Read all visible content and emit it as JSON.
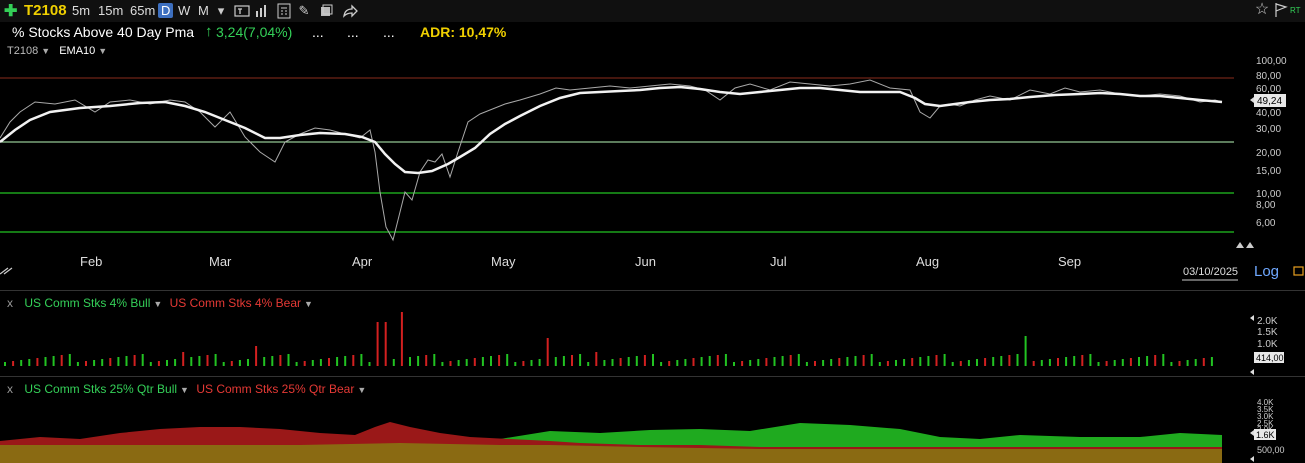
{
  "toolbar": {
    "ticker": "T2108",
    "timeframes": [
      "5m",
      "15m",
      "65m",
      "D",
      "W",
      "M"
    ],
    "active_timeframe": "D"
  },
  "header": {
    "title": "% Stocks Above 40 Day Pma",
    "change": "3,24(7,04%)",
    "dots": [
      "...",
      "...",
      "..."
    ],
    "adr": "ADR: 10,47%",
    "rt_label": "RT"
  },
  "main_panel": {
    "legend_symbol": "T2108",
    "legend_indicator": "EMA10",
    "y_ticks": [
      "100,00",
      "80,00",
      "60,00",
      "50,00",
      "40,00",
      "30,00",
      "20,00",
      "15,00",
      "10,00",
      "8,00",
      "6,00"
    ],
    "y_values": [
      100,
      80,
      60,
      50,
      40,
      30,
      20,
      15,
      10,
      8,
      6
    ],
    "last_value": "49,24",
    "months": [
      "Feb",
      "Mar",
      "Apr",
      "May",
      "Jun",
      "Jul",
      "Aug",
      "Sep"
    ],
    "date": "03/10/2025",
    "log_label": "Log"
  },
  "panel2": {
    "close": "x",
    "bull_label": "US Comm Stks 4% Bull",
    "bear_label": "US Comm Stks 4% Bear",
    "y_ticks": [
      "2.0K",
      "1.5K",
      "1.0K"
    ],
    "last_value": "414,00"
  },
  "panel3": {
    "close": "x",
    "bull_label": "US Comm Stks 25% Qtr Bull",
    "bear_label": "US Comm Stks 25% Qtr Bear",
    "y_ticks": [
      "4.0K",
      "3.5K",
      "3.0K",
      "2.5K",
      "2.0K",
      "1.6K",
      "500,00"
    ],
    "last_value": "1.6K"
  },
  "colors": {
    "bull": "#22c322",
    "bear": "#d32020",
    "ticker": "#f0d000",
    "adr": "#f0d000",
    "change": "#34d058"
  }
}
